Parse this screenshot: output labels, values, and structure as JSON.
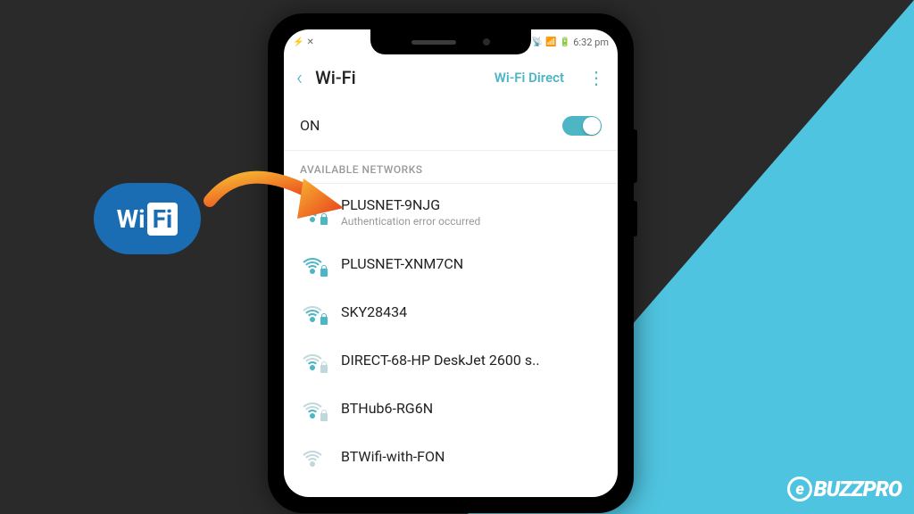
{
  "status_bar": {
    "time": "6:32 pm",
    "battery": "🔋",
    "signal": "📶"
  },
  "nav": {
    "title": "Wi-Fi",
    "wifi_direct": "Wi-Fi Direct"
  },
  "toggle": {
    "label": "ON",
    "state": true
  },
  "section_header": "AVAILABLE NETWORKS",
  "networks": [
    {
      "name": "PLUSNET-9NJG",
      "subtitle": "Authentication error occurred",
      "locked": true,
      "strength": "strong"
    },
    {
      "name": "PLUSNET-XNM7CN",
      "subtitle": "",
      "locked": true,
      "strength": "strong"
    },
    {
      "name": "SKY28434",
      "subtitle": "",
      "locked": true,
      "strength": "medium"
    },
    {
      "name": "DIRECT-68-HP DeskJet 2600 s..",
      "subtitle": "",
      "locked": true,
      "strength": "weak"
    },
    {
      "name": "BTHub6-RG6N",
      "subtitle": "",
      "locked": true,
      "strength": "weak"
    },
    {
      "name": "BTWifi-with-FON",
      "subtitle": "",
      "locked": false,
      "strength": "weak"
    }
  ],
  "wifi_logo": {
    "text_wi": "Wi",
    "text_fi": "Fi"
  },
  "watermark": "BUZZPRO"
}
